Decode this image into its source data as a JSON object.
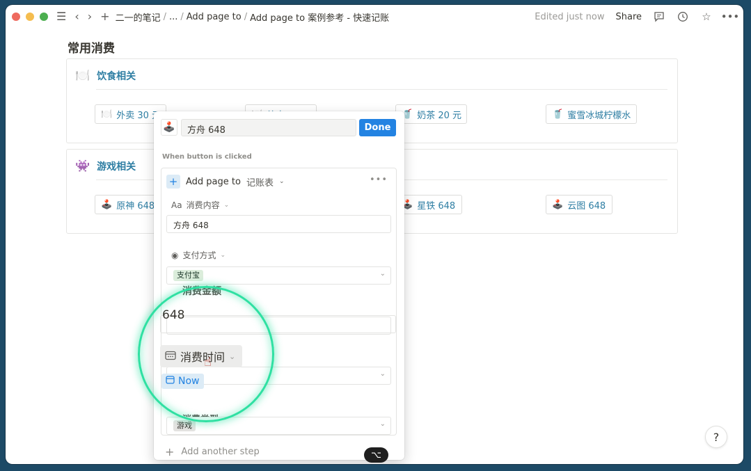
{
  "titlebar": {
    "crumbs": [
      "二一的笔记",
      "...",
      "Add page to",
      "Add page to 案例参考 - 快速记账"
    ],
    "edited": "Edited just now",
    "share": "Share"
  },
  "page": {
    "title": "常用消费",
    "sections": [
      {
        "emoji": "🍽️",
        "label": "饮食相关",
        "buttons": [
          {
            "icon": "🍽️",
            "label": "外卖 30 元"
          },
          {
            "icon": "🍽️",
            "label": "外卖 30 元"
          },
          {
            "icon": "🥤",
            "label": "奶茶 20 元"
          },
          {
            "icon": "🥤",
            "label": "蜜雪冰城柠檬水"
          }
        ]
      },
      {
        "emoji": "👾",
        "label": "游戏相关",
        "buttons": [
          {
            "icon": "🕹️",
            "label": "原神 648"
          },
          {
            "icon": "🕹️",
            "label": "星铁 648"
          },
          {
            "icon": "🕹️",
            "label": "云图 648"
          }
        ]
      }
    ]
  },
  "popup": {
    "emoji": "🕹️",
    "button_name": "方舟 648",
    "done": "Done",
    "when_label": "When button is clicked",
    "step": {
      "action": "Add page to",
      "database": "记账表",
      "more": "•••",
      "props": [
        {
          "icon": "Aa",
          "name": "消费内容",
          "value": "方舟 648"
        },
        {
          "icon": "◉",
          "name": "支付方式",
          "value": "支付宝"
        },
        {
          "icon": "#",
          "name": "消费金额",
          "value": "648"
        },
        {
          "icon": "▦",
          "name": "消费时间",
          "value": "Now"
        },
        {
          "icon": "◉",
          "name": "消费类型",
          "value": "游戏"
        }
      ]
    },
    "add_step": "Add another step",
    "kbd": "⌥"
  },
  "help": "?",
  "colors": {
    "accent": "#2383e2",
    "link": "#2e7ea3",
    "ring": "#2fe0a2"
  }
}
